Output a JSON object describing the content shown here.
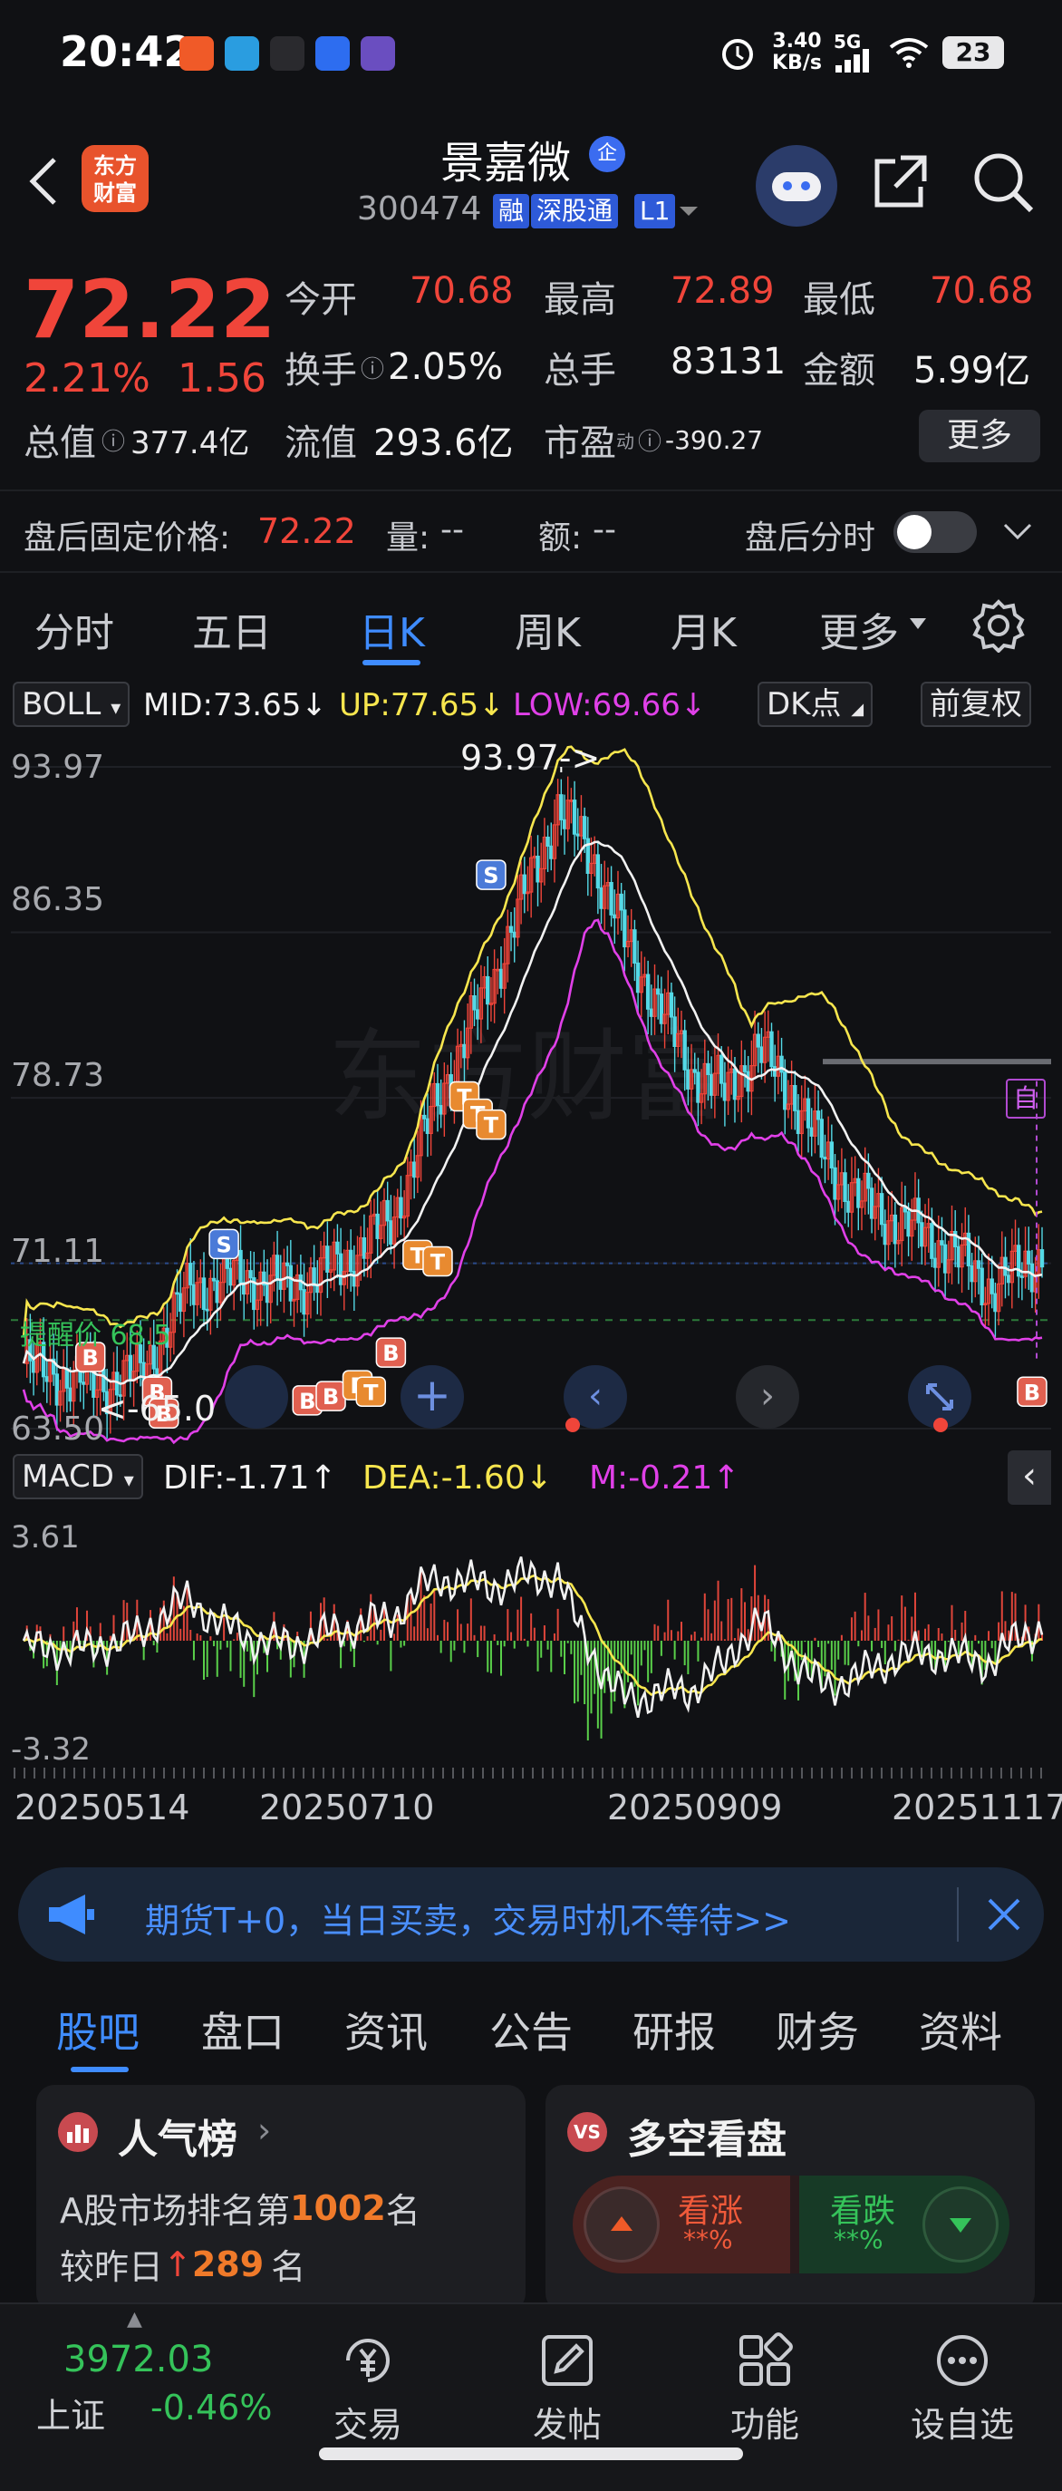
{
  "status": {
    "time": "20:42",
    "net_speed": "3.40",
    "net_unit": "KB/s",
    "signal": "5G",
    "battery": "23"
  },
  "header": {
    "logo_line1": "东方",
    "logo_line2": "财富",
    "name": "景嘉微",
    "name_badge": "企",
    "code": "300474",
    "tags": [
      "融",
      "深股通",
      "L1"
    ]
  },
  "quote": {
    "price": "72.22",
    "change_pct": "2.21%",
    "change": "1.56",
    "total_value_label": "总值",
    "total_value": "377.4亿",
    "open_label": "今开",
    "open": "70.68",
    "high_label": "最高",
    "high": "72.89",
    "low_label": "最低",
    "low": "70.68",
    "turnover_label": "换手",
    "turnover": "2.05%",
    "volume_label": "总手",
    "volume": "83131",
    "amount_label": "金额",
    "amount": "5.99亿",
    "float_label": "流值",
    "float_value": "293.6亿",
    "pe_label": "市盈",
    "pe_sup": "动",
    "pe": "-390.27",
    "more": "更多"
  },
  "after_hours": {
    "fixed_label": "盘后固定价格:",
    "fixed_price": "72.22",
    "vol_label": "量:",
    "vol": "--",
    "amt_label": "额:",
    "amt": "--",
    "timeshare_label": "盘后分时"
  },
  "kline_tabs": [
    "分时",
    "五日",
    "日K",
    "周K",
    "月K",
    "更多"
  ],
  "boll": {
    "name": "BOLL",
    "mid": "MID:73.65",
    "up": "UP:77.65",
    "low": "LOW:69.66",
    "dk": "DK点",
    "adjust": "前复权"
  },
  "kchart": {
    "y_labels": [
      "93.97",
      "86.35",
      "78.73",
      "71.11",
      "63.50"
    ],
    "max_note": "93.97->",
    "min_note": "<-65.0",
    "alert_label": "提醒价 68.5",
    "self_tag": "自"
  },
  "macd": {
    "name": "MACD",
    "dif": "DIF:-1.71",
    "dea": "DEA:-1.60",
    "m": "M:-0.21",
    "y_top": "3.61",
    "y_bottom": "-3.32"
  },
  "dates": [
    "20250514",
    "20250710",
    "20250909",
    "20251117"
  ],
  "banner": {
    "text": "期货T+0，当日买卖，交易时机不等待>>"
  },
  "bottom_tabs": [
    "股吧",
    "盘口",
    "资讯",
    "公告",
    "研报",
    "财务",
    "资料"
  ],
  "popularity": {
    "title": "人气榜",
    "rank_prefix": "A股市场排名第",
    "rank": "1002",
    "rank_suffix": "名",
    "change_prefix": "较昨日",
    "change": "289",
    "change_suffix": "名"
  },
  "sentiment": {
    "title": "多空看盘",
    "bull": "看涨",
    "bear": "看跌",
    "bull_pct": "**%",
    "bear_pct": "**%"
  },
  "index": {
    "value": "3972.03",
    "name": "上证",
    "change": "-0.46%"
  },
  "nav": [
    "交易",
    "发帖",
    "功能",
    "设自选"
  ],
  "colors": {
    "up": "#f0453a",
    "down": "#35c35a",
    "accent": "#3f8cff",
    "upper_band": "#f7e64e",
    "lower_band": "#e040e8"
  }
}
